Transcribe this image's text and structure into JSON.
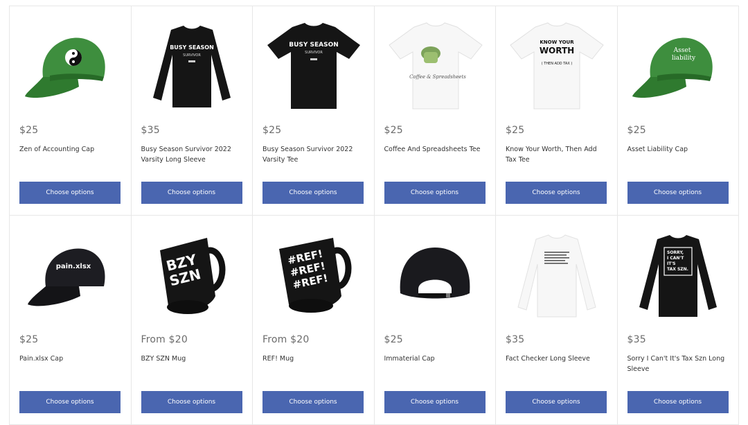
{
  "products": [
    {
      "price": "$25",
      "name": "Zen of Accounting Cap",
      "button": "Choose options",
      "icon": "green-cap-yin-yang"
    },
    {
      "price": "$35",
      "name": "Busy Season Survivor 2022 Varsity Long Sleeve",
      "button": "Choose options",
      "icon": "black-long-sleeve",
      "print": [
        "BUSY SEASON",
        "SURVIVOR"
      ]
    },
    {
      "price": "$25",
      "name": "Busy Season Survivor 2022 Varsity Tee",
      "button": "Choose options",
      "icon": "black-tee",
      "print": [
        "BUSY SEASON",
        "SURVIVOR"
      ]
    },
    {
      "price": "$25",
      "name": "Coffee And Spreadsheets Tee",
      "button": "Choose options",
      "icon": "white-tee-coffee",
      "print": [
        "Coffee & Spreadsheets"
      ]
    },
    {
      "price": "$25",
      "name": "Know Your Worth, Then Add Tax Tee",
      "button": "Choose options",
      "icon": "white-tee-text",
      "print": [
        "KNOW YOUR",
        "WORTH",
        "( THEN ADD TAX )"
      ]
    },
    {
      "price": "$25",
      "name": "Asset Liability Cap",
      "button": "Choose options",
      "icon": "green-cap-text",
      "print": [
        "Asset",
        "liability"
      ]
    },
    {
      "price": "$25",
      "name": "Pain.xlsx Cap",
      "button": "Choose options",
      "icon": "black-cap-text",
      "print": [
        "pain.xlsx"
      ]
    },
    {
      "price": "From $20",
      "name": "BZY SZN Mug",
      "button": "Choose options",
      "icon": "black-mug",
      "print": [
        "BZY",
        "SZN"
      ]
    },
    {
      "price": "From $20",
      "name": "REF! Mug",
      "button": "Choose options",
      "icon": "black-mug",
      "print": [
        "#REF!",
        "#REF!",
        "#REF!"
      ]
    },
    {
      "price": "$25",
      "name": "Immaterial Cap",
      "button": "Choose options",
      "icon": "black-cap-back"
    },
    {
      "price": "$35",
      "name": "Fact Checker Long Sleeve",
      "button": "Choose options",
      "icon": "white-long-sleeve-list"
    },
    {
      "price": "$35",
      "name": "Sorry I Can't It's Tax Szn Long Sleeve",
      "button": "Choose options",
      "icon": "black-long-sleeve-box",
      "print": [
        "SORRY,",
        "I CAN'T",
        "IT'S",
        "TAX SZN."
      ]
    }
  ]
}
